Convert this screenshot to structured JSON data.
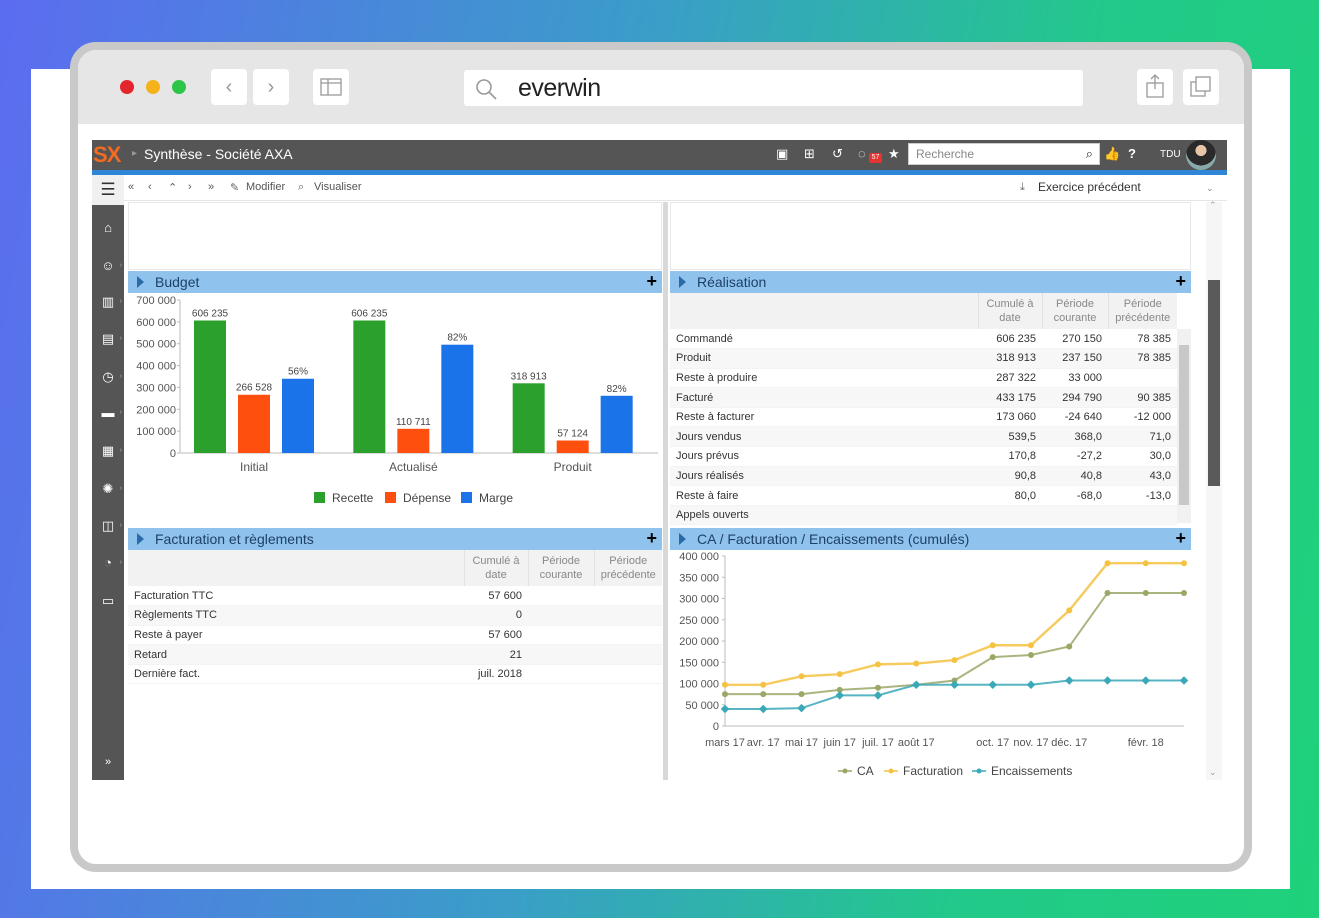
{
  "browser": {
    "url": "everwin"
  },
  "app": {
    "logo": "SX",
    "title": "Synthèse - Société AXA",
    "search_placeholder": "Recherche",
    "notification_count": "57",
    "user_initials": "TDU",
    "toolbar": {
      "nav": [
        "«",
        "‹",
        "⌃",
        "›",
        "»"
      ],
      "modify": "Modifier",
      "view": "Visualiser",
      "exercise": "Exercice précédent"
    }
  },
  "budget": {
    "title": "Budget",
    "legend": [
      "Recette",
      "Dépense",
      "Marge"
    ]
  },
  "realisation": {
    "title": "Réalisation",
    "headers": [
      "Cumulé à date",
      "Période courante",
      "Période précédente"
    ],
    "rows": [
      {
        "label": "Commandé",
        "c": "606 235",
        "p": "270 150",
        "pp": "78 385"
      },
      {
        "label": "Produit",
        "c": "318 913",
        "p": "237 150",
        "pp": "78 385"
      },
      {
        "label": "Reste à produire",
        "c": "287 322",
        "p": "33 000",
        "pp": ""
      },
      {
        "label": "Facturé",
        "c": "433 175",
        "p": "294 790",
        "pp": "90 385"
      },
      {
        "label": "Reste à facturer",
        "c": "173 060",
        "p": "-24 640",
        "pp": "-12 000"
      },
      {
        "label": "Jours vendus",
        "c": "539,5",
        "p": "368,0",
        "pp": "71,0"
      },
      {
        "label": "Jours prévus",
        "c": "170,8",
        "p": "-27,2",
        "pp": "30,0"
      },
      {
        "label": "Jours réalisés",
        "c": "90,8",
        "p": "40,8",
        "pp": "43,0"
      },
      {
        "label": "Reste à faire",
        "c": "80,0",
        "p": "-68,0",
        "pp": "-13,0"
      },
      {
        "label": "Appels ouverts",
        "c": "",
        "p": "",
        "pp": ""
      }
    ]
  },
  "facturation": {
    "title": "Facturation et règlements",
    "headers": [
      "Cumulé à date",
      "Période courante",
      "Période précédente"
    ],
    "rows": [
      {
        "label": "Facturation TTC",
        "c": "57 600"
      },
      {
        "label": "Règlements TTC",
        "c": "0"
      },
      {
        "label": "Reste à payer",
        "c": "57 600"
      },
      {
        "label": "Retard",
        "c": "21"
      },
      {
        "label": "Dernière fact.",
        "c": "juil. 2018"
      }
    ]
  },
  "ca": {
    "title": "CA / Facturation / Encaissements (cumulés)"
  },
  "colors": {
    "recette": "#2ca02c",
    "depense": "#ff4f0f",
    "marge": "#1a73e8",
    "ca": "#9aa867",
    "facturation": "#f5c242",
    "encaissements": "#3aa8b8"
  },
  "chart_data": [
    {
      "type": "bar",
      "categories": [
        "Initial",
        "Actualisé",
        "Produit"
      ],
      "series": [
        {
          "name": "Recette",
          "values": [
            606235,
            606235,
            318913
          ],
          "labels": [
            "606 235",
            "606 235",
            "318 913"
          ]
        },
        {
          "name": "Dépense",
          "values": [
            266528,
            110711,
            57124
          ],
          "labels": [
            "266 528",
            "110 711",
            "57 124"
          ]
        },
        {
          "name": "Marge",
          "values": [
            339707,
            495524,
            261789
          ],
          "labels": [
            "56%",
            "82%",
            "82%"
          ]
        }
      ],
      "yticks": [
        "700 000",
        "600 000",
        "500 000",
        "400 000",
        "300 000",
        "200 000",
        "100 000",
        "0"
      ],
      "ylim": [
        0,
        700000
      ],
      "legend": "bottom"
    },
    {
      "type": "line",
      "x": [
        "mars 17",
        "avr. 17",
        "mai 17",
        "juin 17",
        "juil. 17",
        "août 17",
        "sept. 17",
        "oct. 17",
        "nov. 17",
        "déc. 17",
        "janv. 18",
        "févr. 18",
        "mars 18"
      ],
      "xticks": [
        "mars 17",
        "avr. 17",
        "mai 17",
        "juin 17",
        "juil. 17",
        "août 17",
        "oct. 17",
        "nov. 17",
        "déc. 17",
        "févr. 18"
      ],
      "series": [
        {
          "name": "CA",
          "values": [
            75000,
            75000,
            75000,
            85000,
            90000,
            97000,
            107000,
            162000,
            167000,
            187000,
            313000,
            313000,
            313000
          ]
        },
        {
          "name": "Facturation",
          "values": [
            97000,
            97000,
            117000,
            122000,
            145000,
            147000,
            155000,
            190000,
            190000,
            272000,
            383000,
            383000,
            383000
          ]
        },
        {
          "name": "Encaissements",
          "values": [
            40000,
            40000,
            42000,
            72000,
            72000,
            97000,
            97000,
            97000,
            97000,
            107000,
            107000,
            107000,
            107000
          ]
        }
      ],
      "yticks": [
        "400 000",
        "350 000",
        "300 000",
        "250 000",
        "200 000",
        "150 000",
        "100 000",
        "50 000",
        "0"
      ],
      "ylim": [
        0,
        400000
      ],
      "legend": "bottom"
    }
  ]
}
